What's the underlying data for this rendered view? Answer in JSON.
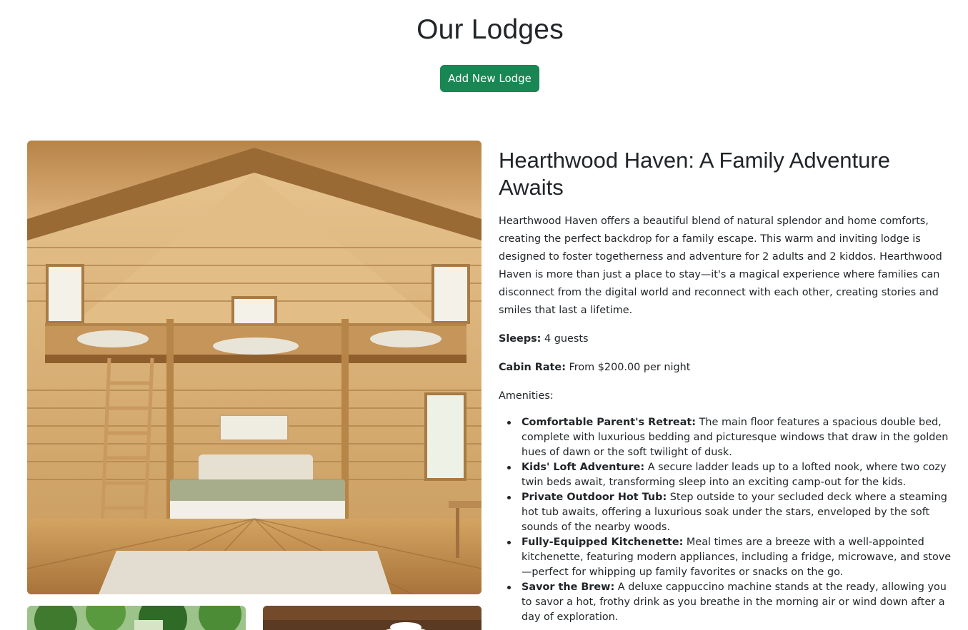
{
  "header": {
    "title": "Our Lodges",
    "add_button_label": "Add New Lodge"
  },
  "lodge": {
    "title": "Hearthwood Haven: A Family Adventure Awaits",
    "description": "Hearthwood Haven offers a beautiful blend of natural splendor and home comforts, creating the perfect backdrop for a family escape. This warm and inviting lodge is designed to foster togetherness and adventure for 2 adults and 2 kiddos. Hearthwood Haven is more than just a place to stay—it's a magical experience where families can disconnect from the digital world and reconnect with each other, creating stories and smiles that last a lifetime.",
    "sleeps_label": "Sleeps:",
    "sleeps_value": "4 guests",
    "rate_label": "Cabin Rate:",
    "rate_value": "From $200.00 per night",
    "amenities_label": "Amenities:",
    "amenities": [
      {
        "name": "Comfortable Parent's Retreat:",
        "text": "The main floor features a spacious double bed, complete with luxurious bedding and picturesque windows that draw in the golden hues of dawn or the soft twilight of dusk."
      },
      {
        "name": "Kids' Loft Adventure:",
        "text": "A secure ladder leads up to a lofted nook, where two cozy twin beds await, transforming sleep into an exciting camp-out for the kids."
      },
      {
        "name": "Private Outdoor Hot Tub:",
        "text": "Step outside to your secluded deck where a steaming hot tub awaits, offering a luxurious soak under the stars, enveloped by the soft sounds of the nearby woods."
      },
      {
        "name": "Fully-Equipped Kitchenette:",
        "text": "Meal times are a breeze with a well-appointed kitchenette, featuring modern appliances, including a fridge, microwave, and stove—perfect for whipping up family favorites or snacks on the go."
      },
      {
        "name": "Savor the Brew:",
        "text": "A deluxe cappuccino machine stands at the ready, allowing you to savor a hot, frothy drink as you breathe in the morning air or wind down after a day of exploration."
      }
    ]
  },
  "colors": {
    "primary_button": "#198754",
    "text": "#212529"
  }
}
